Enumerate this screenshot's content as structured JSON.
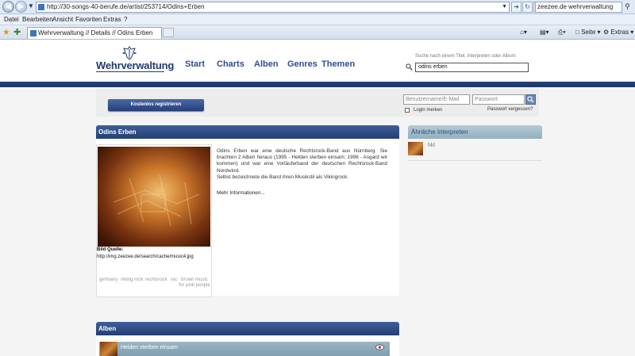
{
  "browser": {
    "url": "http://30-songs-40-berufe.de/artist/253714/Odins+Erben",
    "search_text": "zeezee.de wehrverwaltung",
    "menu": [
      "Datei",
      "Bearbeiten",
      "Ansicht",
      "Favoriten",
      "Extras",
      "?"
    ],
    "tab_title": "Wehrverwaltung // Details // Odins Erben",
    "toolbar": {
      "page": "Seite",
      "extras": "Extras"
    }
  },
  "site": {
    "logo": "Wehrverwaltung",
    "nav": [
      "Start",
      "Charts",
      "Alben",
      "Genres",
      "Themen"
    ],
    "search_hint": "Suche nach einem Titel, Interpreten oder Album",
    "search_value": "odins erben",
    "register_label": "Kostenlos registrieren",
    "username_placeholder": "Benutzername/E-Mail",
    "password_placeholder": "Passwort",
    "remember_label": "Login merken",
    "forgot_label": "Passwort vergessen?"
  },
  "artist": {
    "title": "Odins Erben",
    "description": "Odins Erben war eine deutsche Rechtsrock-Band aus Nürnberg. Sie brachten 2 Alben heraus (1995 - Helden sterben einsam; 1996 - Asgard wir kommen) und war eine Vorläuferband der deutschen Rechtsrock-Band Nordwind.",
    "description2": "Selbst bezeichnete die Band ihren Musikstil als Vikingrock.",
    "more_label": "Mehr Informationen...",
    "image_source_label": "Bild Quelle:",
    "image_source_url": "http://img.zeezee.de/search/cache/music4.jpg",
    "tags": [
      "germany",
      "viking rock",
      "rechtsrock",
      "rac",
      "brown music for pink people"
    ]
  },
  "similar": {
    "title": "Ähnliche Interpreten",
    "items": [
      {
        "name": "hkl"
      }
    ]
  },
  "albums": {
    "title": "Alben",
    "items": [
      {
        "title": "Helden sterben einsam"
      }
    ]
  }
}
